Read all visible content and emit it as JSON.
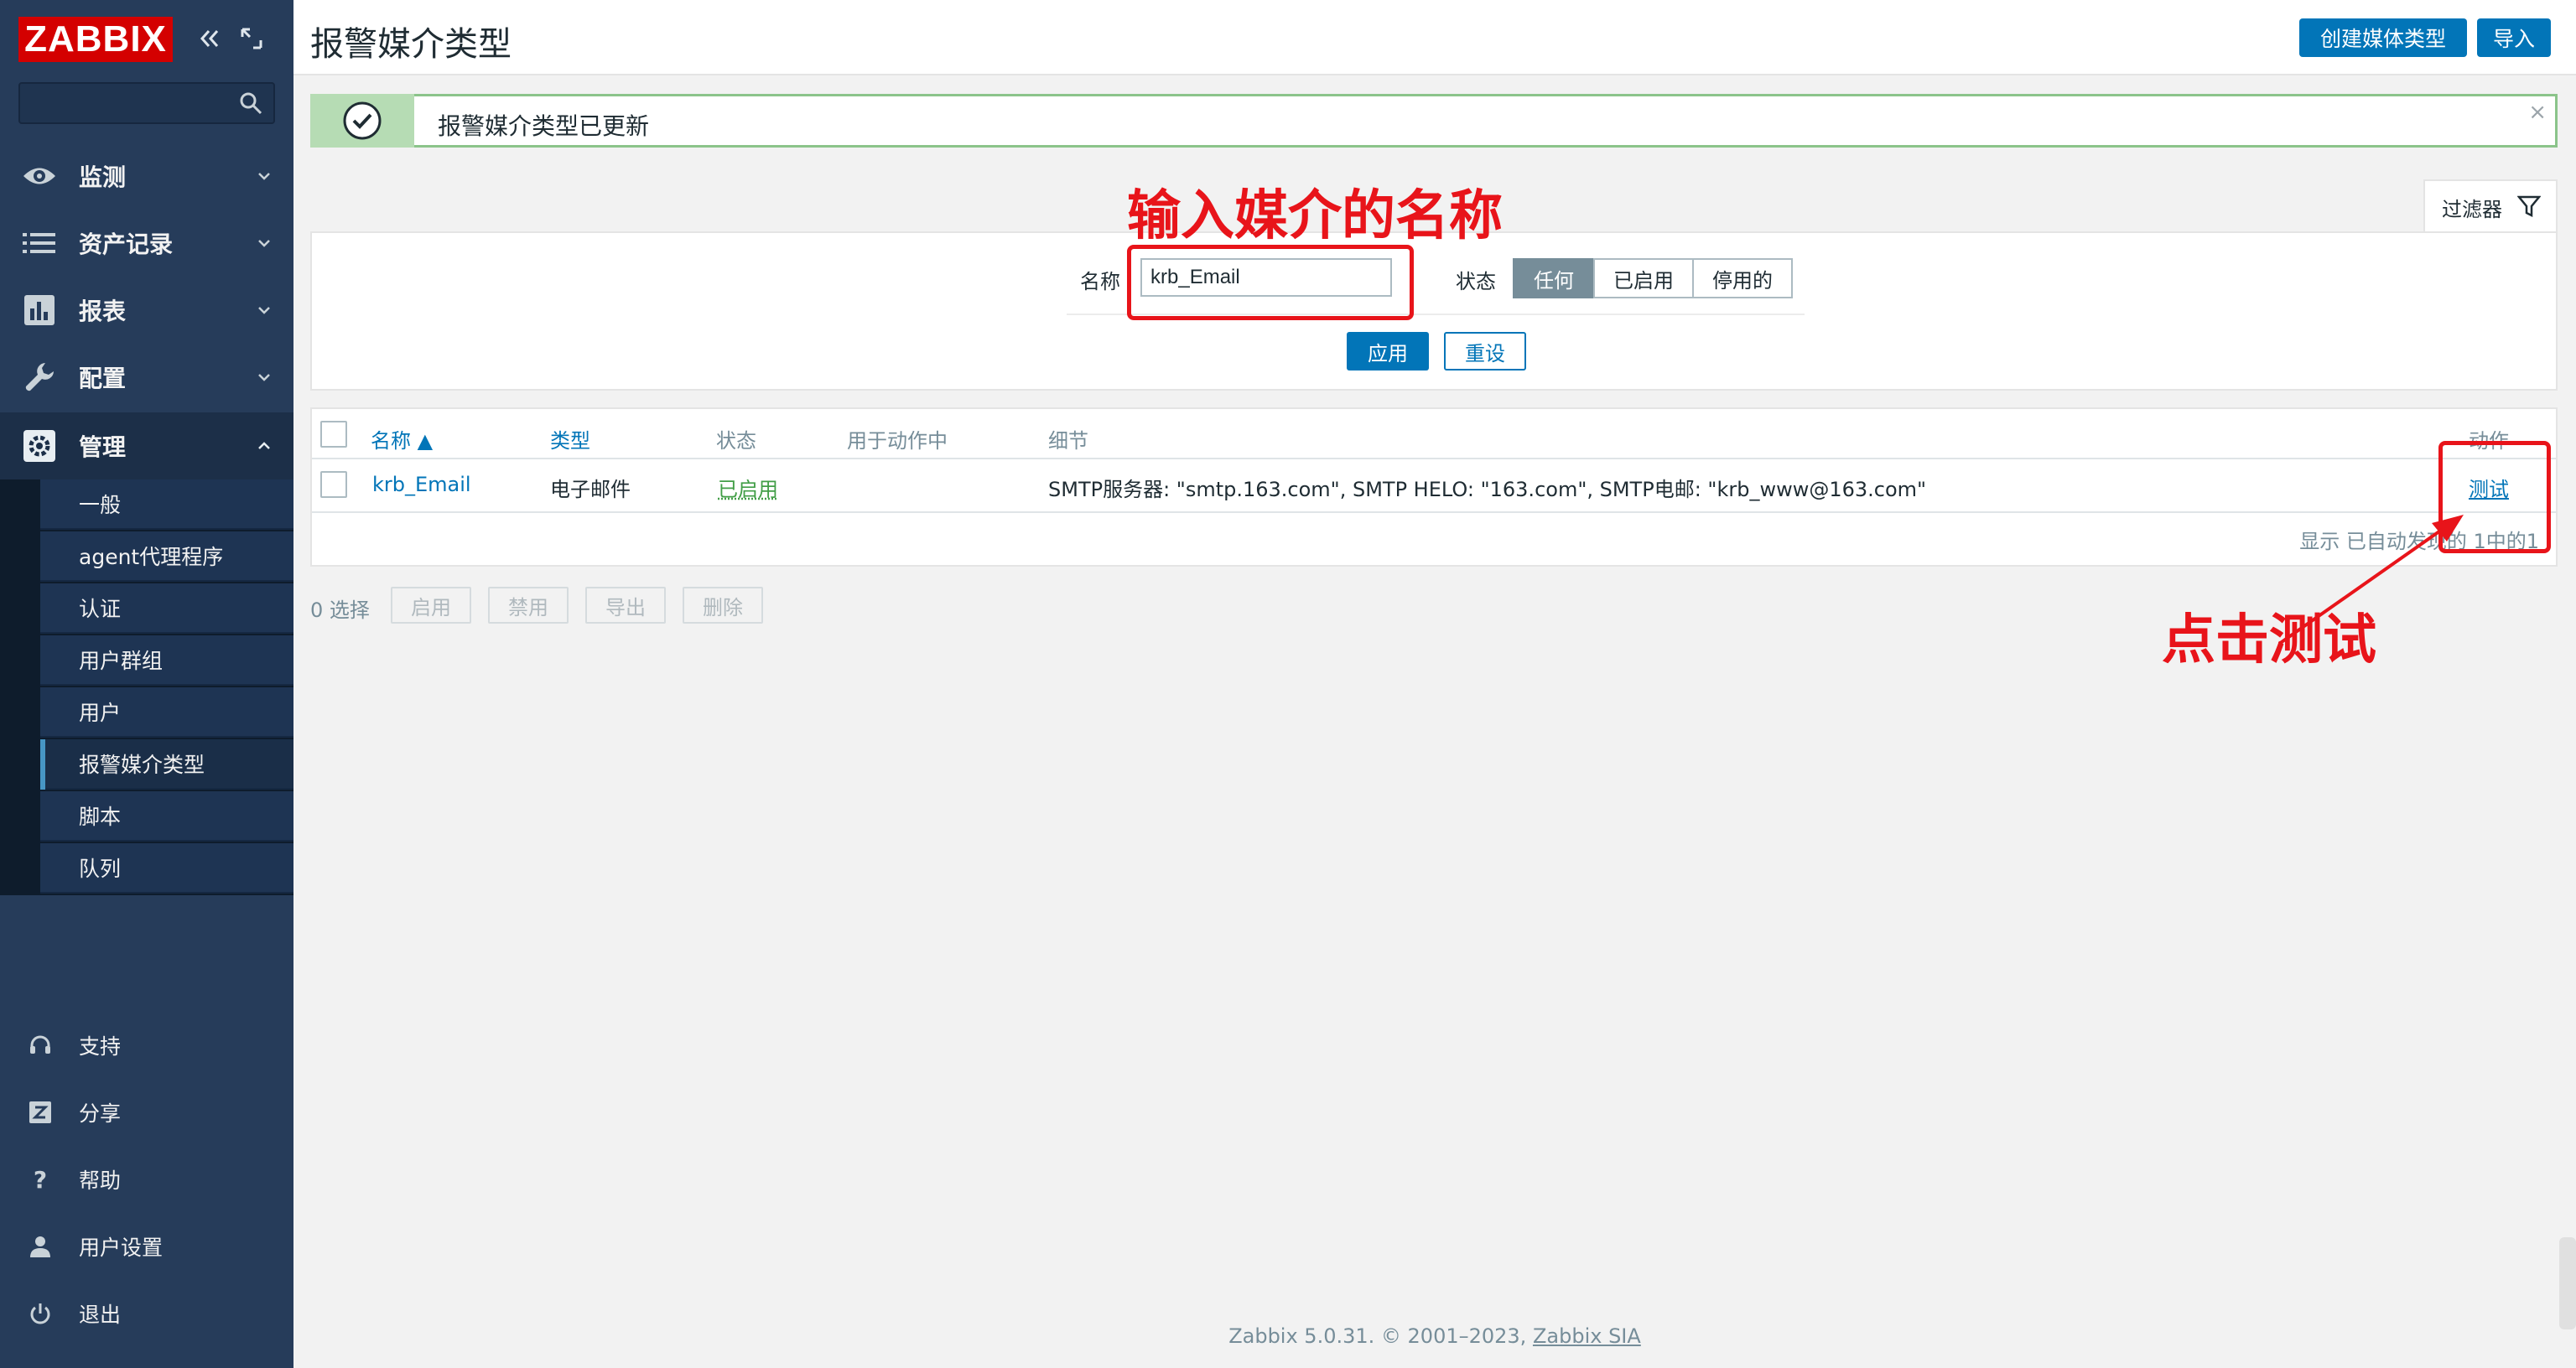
{
  "brand": {
    "logo_text": "ZABBIX"
  },
  "sidebar": {
    "search_placeholder": "",
    "menu": [
      {
        "label": "监测",
        "icon": "eye-icon"
      },
      {
        "label": "资产记录",
        "icon": "list-icon"
      },
      {
        "label": "报表",
        "icon": "bar-chart-icon"
      },
      {
        "label": "配置",
        "icon": "wrench-icon"
      },
      {
        "label": "管理",
        "icon": "gear-icon"
      }
    ],
    "submenu": [
      {
        "label": "一般"
      },
      {
        "label": "agent代理程序"
      },
      {
        "label": "认证"
      },
      {
        "label": "用户群组"
      },
      {
        "label": "用户"
      },
      {
        "label": "报警媒介类型"
      },
      {
        "label": "脚本"
      },
      {
        "label": "队列"
      }
    ],
    "bottom": [
      {
        "label": "支持",
        "icon": "headset-icon"
      },
      {
        "label": "分享",
        "icon": "share-icon"
      },
      {
        "label": "帮助",
        "icon": "help-icon"
      },
      {
        "label": "用户设置",
        "icon": "user-icon"
      },
      {
        "label": "退出",
        "icon": "power-icon"
      }
    ]
  },
  "header": {
    "title": "报警媒介类型",
    "create_label": "创建媒体类型",
    "import_label": "导入"
  },
  "message": {
    "text": "报警媒介类型已更新",
    "close": "×"
  },
  "filter": {
    "tab_label": "过滤器",
    "name_label": "名称",
    "name_value": "krb_Email",
    "status_label": "状态",
    "status_options": [
      "任何",
      "已启用",
      "停用的"
    ],
    "status_selected": "任何",
    "apply_label": "应用",
    "reset_label": "重设"
  },
  "table": {
    "columns": [
      "名称 ▲",
      "类型",
      "状态",
      "用于动作中",
      "细节",
      "动作"
    ],
    "rows": [
      {
        "name": "krb_Email",
        "type": "电子邮件",
        "status": "已启用",
        "used_in_actions": "",
        "details": "SMTP服务器: \"smtp.163.com\", SMTP HELO: \"163.com\", SMTP电邮: \"krb_www@163.com\"",
        "action": "测试"
      }
    ],
    "footer": "显示 已自动发现的 1中的1"
  },
  "selection": {
    "count": "0 选择",
    "buttons": [
      "启用",
      "禁用",
      "导出",
      "删除"
    ]
  },
  "footer": {
    "text": "Zabbix 5.0.31. © 2001–2023, ",
    "company": "Zabbix SIA"
  },
  "annotations": {
    "input_hint": "输入媒介的名称",
    "click_hint": "点击测试",
    "color": "#e8141a"
  }
}
